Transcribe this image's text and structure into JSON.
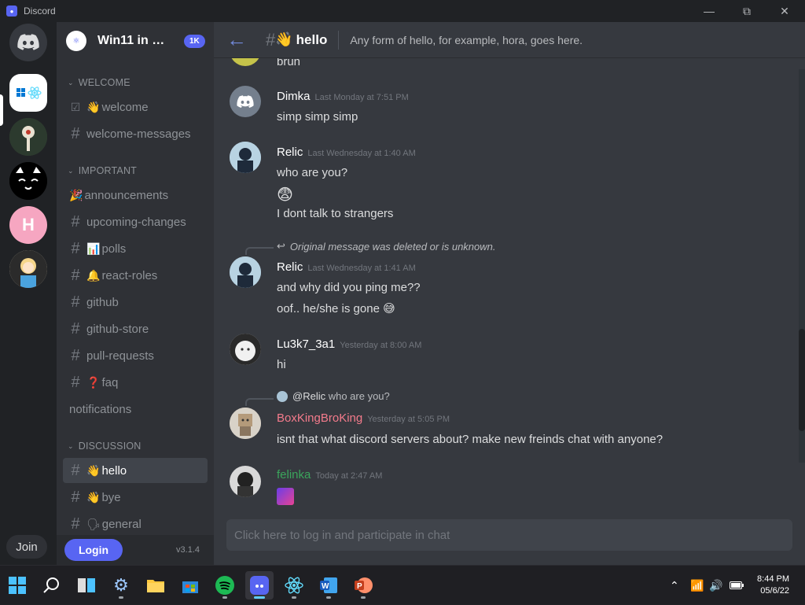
{
  "window": {
    "title": "Discord",
    "minimize": "—",
    "maximize": "⧉",
    "close": "✕"
  },
  "server": {
    "name": "Win11 in Re...",
    "member_badge": "1K"
  },
  "guild_rail": {
    "join_label": "Join"
  },
  "categories": {
    "welcome": "WELCOME",
    "important": "IMPORTANT",
    "discussion": "DISCUSSION"
  },
  "channels": {
    "welcome": "welcome",
    "welcome_messages": "welcome-messages",
    "announcements": "announcements",
    "upcoming_changes": "upcoming-changes",
    "polls": "polls",
    "react_roles": "react-roles",
    "github": "github",
    "github_store": "github-store",
    "pull_requests": "pull-requests",
    "faq": "faq",
    "notifications": "notifications",
    "hello": "hello",
    "bye": "bye",
    "general": "general"
  },
  "sidebar_footer": {
    "login_label": "Login",
    "version": "v3.1.4"
  },
  "header": {
    "channel": "hello",
    "topic": "Any form of hello, for example, hora, goes here."
  },
  "messages": {
    "m0": {
      "text": "brun"
    },
    "m1": {
      "author": "Dimka",
      "time": "Last Monday at 7:51 PM",
      "lines": [
        "simp simp simp"
      ]
    },
    "m2": {
      "author": "Relic",
      "time": "Last Wednesday at 1:40 AM",
      "lines": [
        "who are you?",
        "😨",
        "I dont talk to strangers"
      ]
    },
    "m3": {
      "reply": "Original message was deleted or is unknown.",
      "author": "Relic",
      "time": "Last Wednesday at 1:41 AM",
      "lines": [
        "and why did you ping me??",
        "oof.. he/she is gone 😅"
      ]
    },
    "m4": {
      "author": "Lu3k7_3a1",
      "time": "Yesterday at 8:00 AM",
      "lines": [
        "hi"
      ]
    },
    "m5": {
      "reply_user": "@Relic",
      "reply_text": "who are you?",
      "author": "BoxKingBroKing",
      "time": "Yesterday at 5:05 PM",
      "lines": [
        "isnt that what discord servers about? make new freinds chat with anyone?"
      ]
    },
    "m6": {
      "author": "felinka",
      "time": "Today at 2:47 AM"
    }
  },
  "composer": {
    "placeholder": "Click here to log in and participate in chat"
  },
  "taskbar": {
    "time": "8:44 PM",
    "date": "05/6/22"
  },
  "colors": {
    "blurple": "#5865f2",
    "boxking": "#f47b8c",
    "felinka": "#3ba55c",
    "bg_main": "#36393f",
    "bg_side": "#2f3136"
  }
}
